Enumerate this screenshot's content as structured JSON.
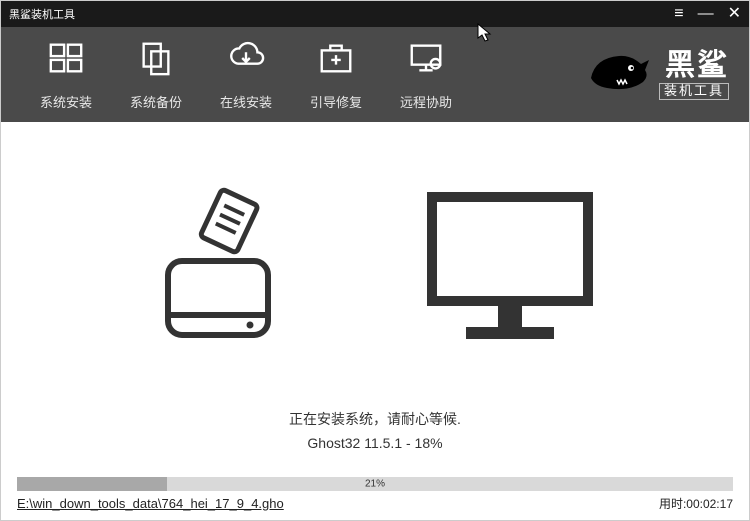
{
  "app_title": "黑鲨装机工具",
  "window_controls": {
    "menu": "≡",
    "minimize": "—",
    "close": "✕"
  },
  "toolbar": {
    "items": [
      {
        "label": "系统安装",
        "icon": "windows-icon"
      },
      {
        "label": "系统备份",
        "icon": "copy-icon"
      },
      {
        "label": "在线安装",
        "icon": "cloud-download-icon"
      },
      {
        "label": "引导修复",
        "icon": "medkit-icon"
      },
      {
        "label": "远程协助",
        "icon": "monitor-user-icon"
      }
    ]
  },
  "brand": {
    "name": "黑鲨",
    "subtitle": "装机工具"
  },
  "status": {
    "message": "正在安装系统，请耐心等候.",
    "detail": "Ghost32 11.5.1 - 18%"
  },
  "progress": {
    "percent": 21,
    "percent_text": "21%"
  },
  "file_path": "E:\\win_down_tools_data\\764_hei_17_9_4.gho",
  "elapsed": {
    "label": "用时:",
    "value": "00:02:17"
  }
}
